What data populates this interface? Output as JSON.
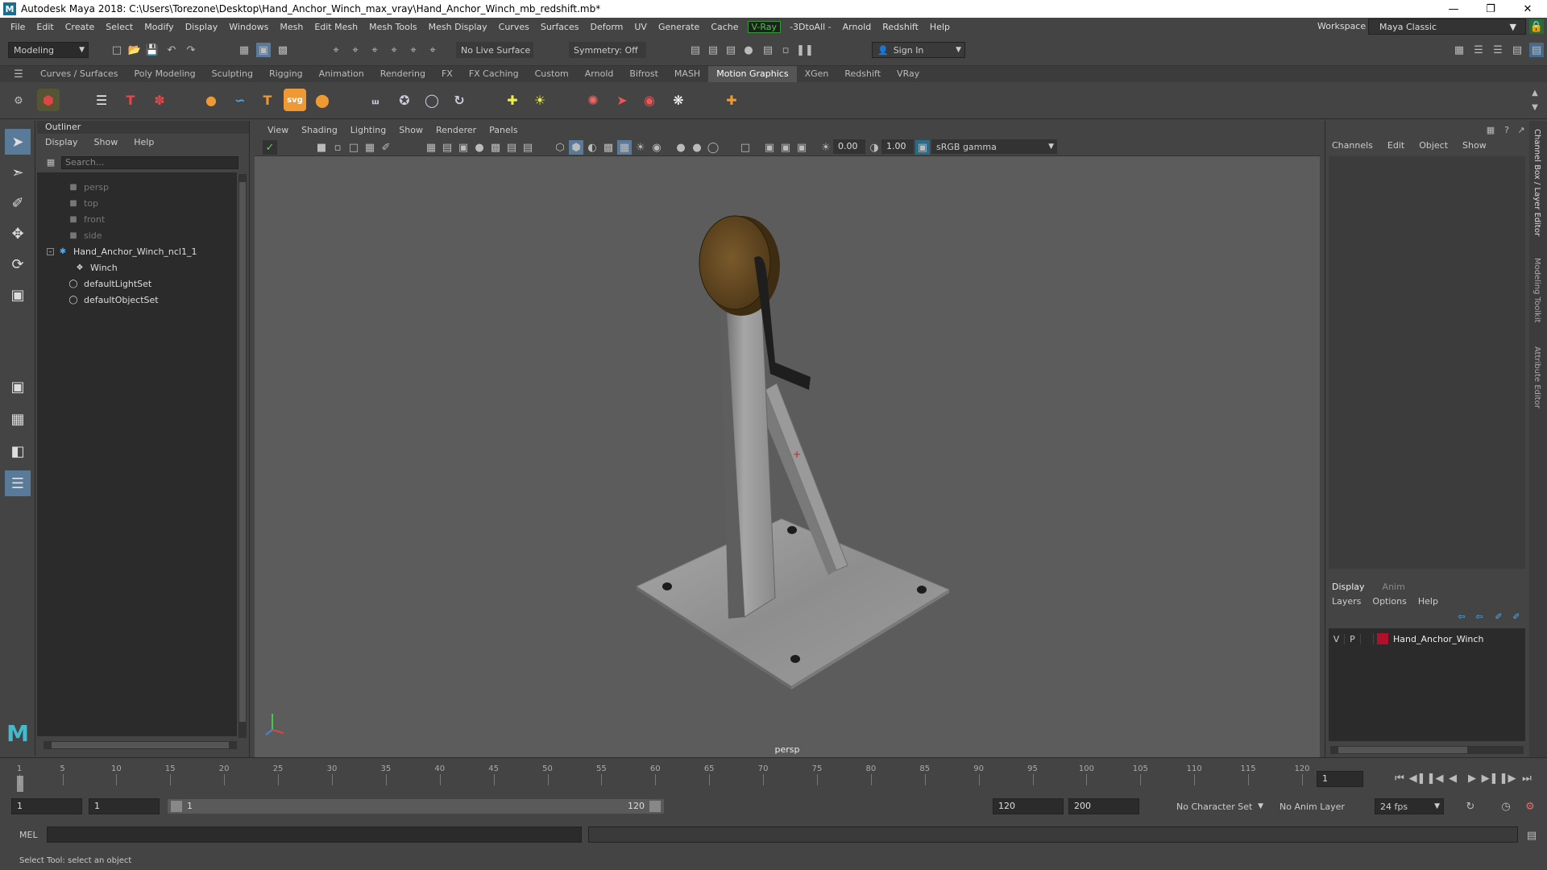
{
  "window": {
    "title": "Autodesk Maya 2018: C:\\Users\\Torezone\\Desktop\\Hand_Anchor_Winch_max_vray\\Hand_Anchor_Winch_mb_redshift.mb*",
    "logo": "M"
  },
  "menubar": {
    "items": [
      "File",
      "Edit",
      "Create",
      "Select",
      "Modify",
      "Display",
      "Windows",
      "Mesh",
      "Edit Mesh",
      "Mesh Tools",
      "Mesh Display",
      "Curves",
      "Surfaces",
      "Deform",
      "UV",
      "Generate",
      "Cache"
    ],
    "vray": "V-Ray",
    "items2": [
      "-3DtoAll -",
      "Arnold",
      "Redshift",
      "Help"
    ],
    "workspace_label": "Workspace :",
    "workspace_value": "Maya Classic"
  },
  "statusline": {
    "mode": "Modeling",
    "live_surface": "No Live Surface",
    "symmetry": "Symmetry: Off",
    "sign_in": "Sign In"
  },
  "shelf": {
    "tabs": [
      "Curves / Surfaces",
      "Poly Modeling",
      "Sculpting",
      "Rigging",
      "Animation",
      "Rendering",
      "FX",
      "FX Caching",
      "Custom",
      "Arnold",
      "Bifrost",
      "MASH",
      "Motion Graphics",
      "XGen",
      "Redshift",
      "VRay"
    ],
    "active_tab": "Motion Graphics",
    "svg_label": "svg"
  },
  "outliner": {
    "title": "Outliner",
    "menus": [
      "Display",
      "Show",
      "Help"
    ],
    "search_placeholder": "Search...",
    "items": [
      {
        "label": "persp",
        "dim": true
      },
      {
        "label": "top",
        "dim": true
      },
      {
        "label": "front",
        "dim": true
      },
      {
        "label": "side",
        "dim": true
      },
      {
        "label": "Hand_Anchor_Winch_ncl1_1",
        "dim": false
      },
      {
        "label": "Winch",
        "dim": false
      },
      {
        "label": "defaultLightSet",
        "dim": false
      },
      {
        "label": "defaultObjectSet",
        "dim": false
      }
    ]
  },
  "viewport": {
    "menus": [
      "View",
      "Shading",
      "Lighting",
      "Show",
      "Renderer",
      "Panels"
    ],
    "exposure": "0.00",
    "gamma": "1.00",
    "color_space": "sRGB gamma",
    "camera_label": "persp"
  },
  "channelbox": {
    "menus": [
      "Channels",
      "Edit",
      "Object",
      "Show"
    ],
    "layer_tabs": [
      "Display",
      "Anim"
    ],
    "layer_menus": [
      "Layers",
      "Options",
      "Help"
    ],
    "layer": {
      "v": "V",
      "p": "P",
      "name": "Hand_Anchor_Winch",
      "color": "#b0102a"
    }
  },
  "sidetabs": [
    "Channel Box / Layer Editor",
    "Modeling Toolkit",
    "Attribute Editor"
  ],
  "timeline": {
    "ticks": [
      1,
      5,
      10,
      15,
      20,
      25,
      30,
      35,
      40,
      45,
      50,
      55,
      60,
      65,
      70,
      75,
      80,
      85,
      90,
      95,
      100,
      105,
      110,
      115,
      120
    ],
    "start_tick": 1,
    "end_tick": 120,
    "current_frame": "1"
  },
  "range": {
    "start": "1",
    "playback_start": "1",
    "slider_start": "1",
    "slider_end": "120",
    "playback_end": "120",
    "end": "200",
    "character_set": "No Character Set",
    "anim_layer": "No Anim Layer",
    "fps": "24 fps"
  },
  "cmdline": {
    "label": "MEL"
  },
  "helpline": {
    "text": "Select Tool: select an object"
  }
}
